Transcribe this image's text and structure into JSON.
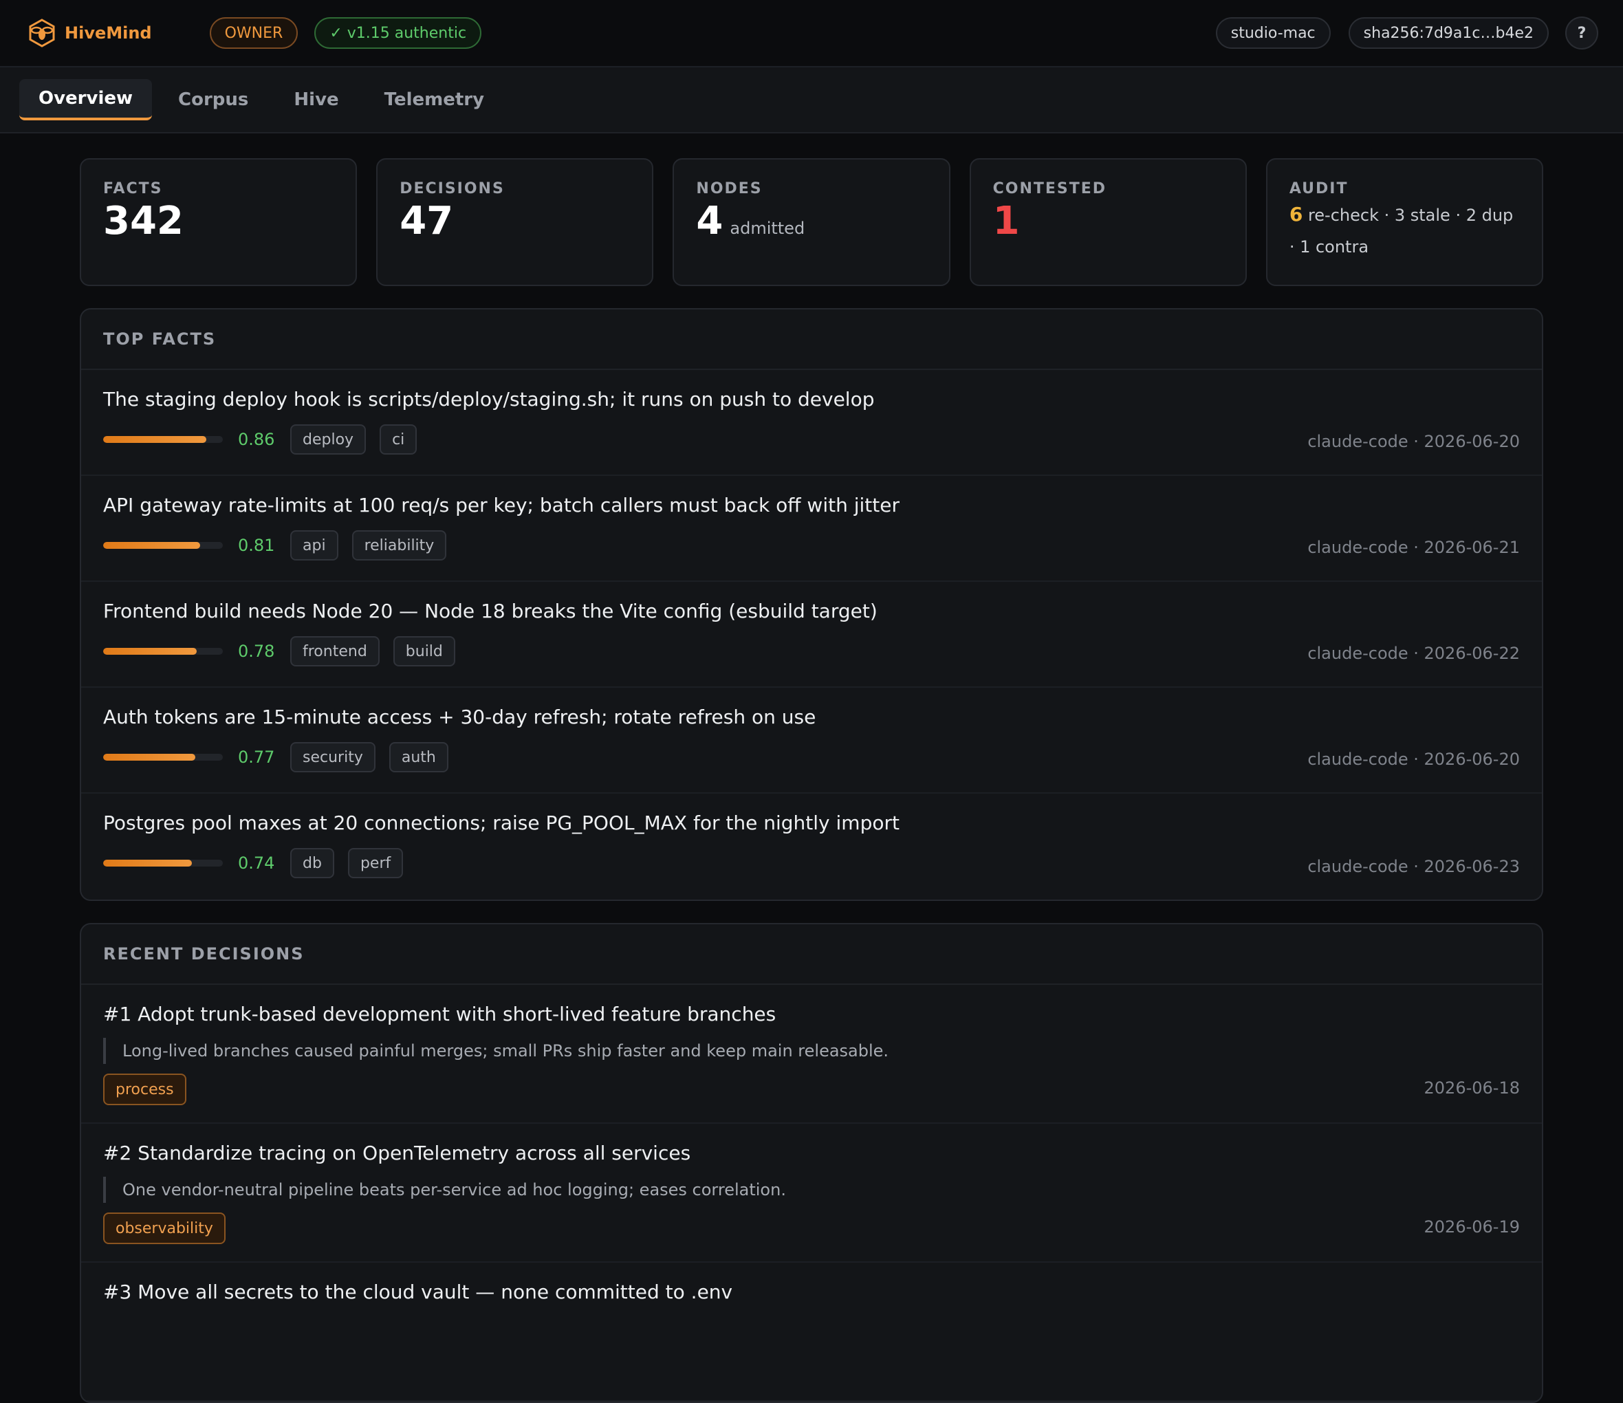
{
  "app": {
    "name": "HiveMind"
  },
  "header": {
    "role_badge": "OWNER",
    "auth_badge": "✓ v1.15 authentic",
    "host": "studio-mac",
    "hash": "sha256:7d9a1c…b4e2",
    "help": "?"
  },
  "tabs": [
    {
      "label": "Overview",
      "active": true
    },
    {
      "label": "Corpus",
      "active": false
    },
    {
      "label": "Hive",
      "active": false
    },
    {
      "label": "Telemetry",
      "active": false
    }
  ],
  "stats": {
    "facts": {
      "label": "FACTS",
      "value": "342"
    },
    "decisions": {
      "label": "DECISIONS",
      "value": "47"
    },
    "nodes": {
      "label": "NODES",
      "value": "4",
      "suffix": "admitted"
    },
    "contested": {
      "label": "CONTESTED",
      "value": "1"
    },
    "audit": {
      "label": "AUDIT",
      "count": "6",
      "line1": "re-check · 3 stale · 2 dup",
      "line2": "· 1 contra"
    }
  },
  "top_facts": {
    "title": "TOP FACTS",
    "items": [
      {
        "text": "The staging deploy hook is scripts/deploy/staging.sh; it runs on push to develop",
        "score": 0.86,
        "score_label": "0.86",
        "tags": [
          "deploy",
          "ci"
        ],
        "meta": "claude-code · 2026-06-20"
      },
      {
        "text": "API gateway rate-limits at 100 req/s per key; batch callers must back off with jitter",
        "score": 0.81,
        "score_label": "0.81",
        "tags": [
          "api",
          "reliability"
        ],
        "meta": "claude-code · 2026-06-21"
      },
      {
        "text": "Frontend build needs Node 20 — Node 18 breaks the Vite config (esbuild target)",
        "score": 0.78,
        "score_label": "0.78",
        "tags": [
          "frontend",
          "build"
        ],
        "meta": "claude-code · 2026-06-22"
      },
      {
        "text": "Auth tokens are 15-minute access + 30-day refresh; rotate refresh on use",
        "score": 0.77,
        "score_label": "0.77",
        "tags": [
          "security",
          "auth"
        ],
        "meta": "claude-code · 2026-06-20"
      },
      {
        "text": "Postgres pool maxes at 20 connections; raise PG_POOL_MAX for the nightly import",
        "score": 0.74,
        "score_label": "0.74",
        "tags": [
          "db",
          "perf"
        ],
        "meta": "claude-code · 2026-06-23"
      }
    ]
  },
  "recent_decisions": {
    "title": "RECENT DECISIONS",
    "items": [
      {
        "title": "#1 Adopt trunk-based development with short-lived feature branches",
        "reason": "Long-lived branches caused painful merges; small PRs ship faster and keep main releasable.",
        "tag": "process",
        "date": "2026-06-18"
      },
      {
        "title": "#2 Standardize tracing on OpenTelemetry across all services",
        "reason": "One vendor-neutral pipeline beats per-service ad hoc logging; eases correlation.",
        "tag": "observability",
        "date": "2026-06-19"
      },
      {
        "title": "#3 Move all secrets to the cloud vault — none committed to .env",
        "reason": "",
        "tag": "",
        "date": ""
      }
    ]
  }
}
